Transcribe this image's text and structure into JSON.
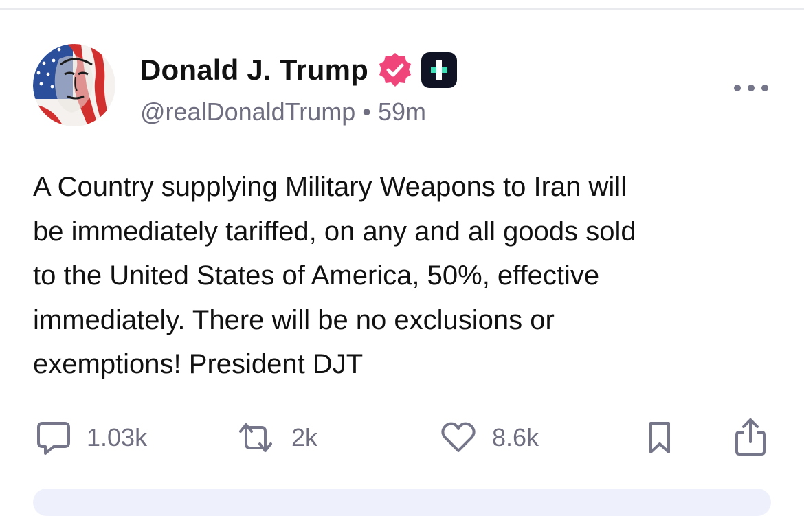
{
  "author": {
    "display_name": "Donald J. Trump",
    "handle": "@realDonaldTrump",
    "separator": "•",
    "time_ago": "59m",
    "verified_icon": "verified-badge-icon",
    "plus_icon": "plus-badge-icon",
    "avatar": "profile-avatar"
  },
  "post": {
    "text": "A Country supplying Military Weapons to Iran will\nbe immediately tariffed, on any and all goods sold\nto the United States of America, 50%, effective\nimmediately. There will be no exclusions or\nexemptions! President DJT"
  },
  "actions": {
    "replies": {
      "count": "1.03k",
      "icon": "reply-icon"
    },
    "reposts": {
      "count": "2k",
      "icon": "repost-icon"
    },
    "likes": {
      "count": "8.6k",
      "icon": "heart-icon"
    },
    "bookmark": {
      "icon": "bookmark-icon"
    },
    "share": {
      "icon": "share-icon"
    }
  },
  "colors": {
    "verified": "#f0457a",
    "plus_badge_bg": "#101324",
    "plus_badge_accent": "#3ee0b7",
    "muted_text": "#6e6e80",
    "icon_gray": "#76768a"
  }
}
